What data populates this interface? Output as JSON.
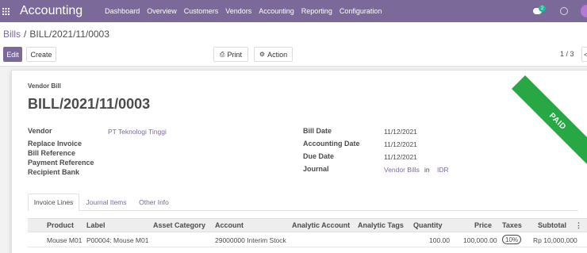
{
  "navbar": {
    "apps_icon": "grid-icon",
    "brand": "Accounting",
    "menu": [
      "Dashboard",
      "Overview",
      "Customers",
      "Vendors",
      "Accounting",
      "Reporting",
      "Configuration"
    ],
    "chat_count": "2",
    "accent": "#7b6a99"
  },
  "breadcrumb": {
    "parent": "Bills",
    "separator": "/",
    "current": "BILL/2021/11/0003"
  },
  "buttons": {
    "edit": "Edit",
    "create": "Create",
    "print": "Print",
    "action": "Action"
  },
  "pager": {
    "text": "1 / 3",
    "prev": "<"
  },
  "document": {
    "type": "Vendor Bill",
    "title": "BILL/2021/11/0003",
    "status_ribbon": "PAID",
    "ribbon_color": "#28a745"
  },
  "fields_left": {
    "vendor_label": "Vendor",
    "vendor_value": "PT Teknologi Tinggi",
    "replace_invoice_label": "Replace Invoice",
    "bill_reference_label": "Bill Reference",
    "payment_reference_label": "Payment Reference",
    "recipient_bank_label": "Recipient Bank"
  },
  "fields_right": {
    "bill_date_label": "Bill Date",
    "bill_date_value": "11/12/2021",
    "accounting_date_label": "Accounting Date",
    "accounting_date_value": "11/12/2021",
    "due_date_label": "Due Date",
    "due_date_value": "11/12/2021",
    "journal_label": "Journal",
    "journal_value": "Vendor Bills",
    "journal_in": "in",
    "journal_currency": "IDR"
  },
  "tabs": [
    "Invoice Lines",
    "Journal Items",
    "Other Info"
  ],
  "table": {
    "headers": [
      "Product",
      "Label",
      "Asset Category",
      "Account",
      "Analytic Account",
      "Analytic Tags",
      "Quantity",
      "Price",
      "Taxes",
      "Subtotal"
    ],
    "rows": [
      {
        "product": "Mouse M01",
        "label": "P00004: Mouse M01",
        "asset_category": "",
        "account": "29000000 Interim Stock",
        "analytic_account": "",
        "analytic_tags": "",
        "quantity": "100.00",
        "price": "100,000.00",
        "taxes": "10%",
        "subtotal": "Rp 10,000,000"
      }
    ]
  }
}
